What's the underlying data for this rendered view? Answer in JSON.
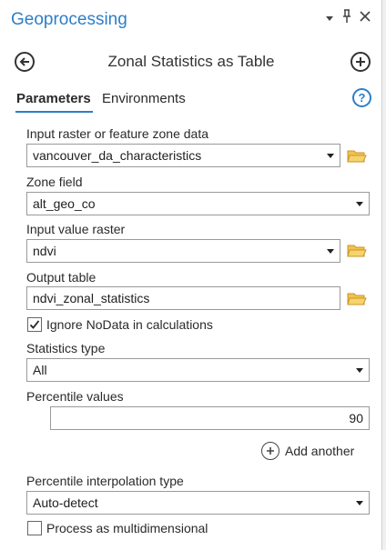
{
  "window": {
    "title": "Geoprocessing",
    "icons": [
      "chevron-down-icon",
      "pin-icon",
      "close-icon"
    ]
  },
  "tool": {
    "title": "Zonal Statistics as Table"
  },
  "tabs": [
    {
      "label": "Parameters",
      "active": true
    },
    {
      "label": "Environments",
      "active": false
    }
  ],
  "accent_color": "#2d7ec9",
  "parameters": {
    "zone_data": {
      "label": "Input raster or feature zone data",
      "value": "vancouver_da_characteristics"
    },
    "zone_field": {
      "label": "Zone field",
      "value": "alt_geo_co"
    },
    "value_raster": {
      "label": "Input value raster",
      "value": "ndvi"
    },
    "output_table": {
      "label": "Output table",
      "value": "ndvi_zonal_statistics"
    },
    "ignore_nodata": {
      "label": "Ignore NoData in calculations",
      "checked": true
    },
    "statistics_type": {
      "label": "Statistics type",
      "value": "All"
    },
    "percentile_values": {
      "label": "Percentile values",
      "value": "90"
    },
    "add_another": {
      "label": "Add another"
    },
    "percentile_interp": {
      "label": "Percentile interpolation type",
      "value": "Auto-detect"
    },
    "multidimensional": {
      "label": "Process as multidimensional",
      "checked": false
    }
  }
}
